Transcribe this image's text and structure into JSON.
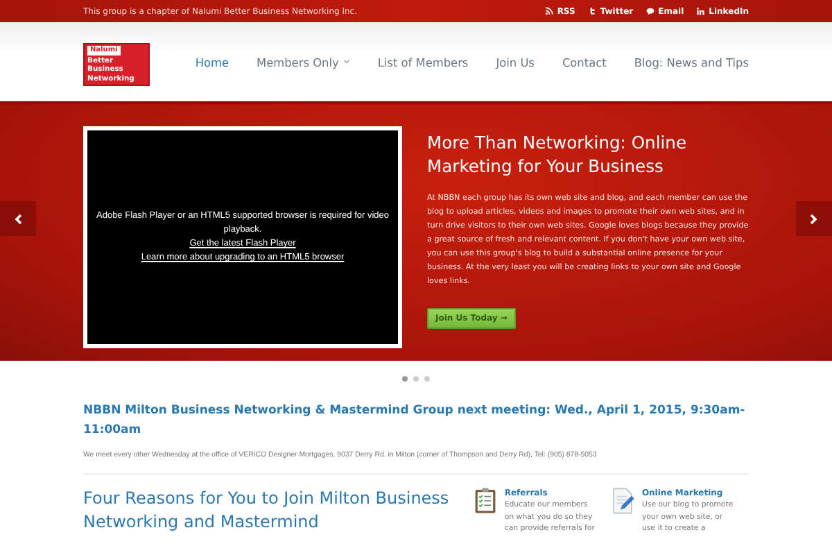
{
  "top_bar": {
    "tagline": "This group is a chapter of Nalumi Better Business Networking Inc.",
    "links": [
      {
        "kind": "rss",
        "label": "RSS"
      },
      {
        "kind": "twitter",
        "label": "Twitter"
      },
      {
        "kind": "email",
        "label": "Email"
      },
      {
        "kind": "linkedin",
        "label": "LinkedIn"
      }
    ]
  },
  "header": {
    "logo": {
      "brand": "Nalumi",
      "lines": [
        "Better",
        "Business",
        "Networking"
      ]
    },
    "nav": [
      {
        "label": "Home",
        "selected": true,
        "dropdown": false
      },
      {
        "label": "Members Only",
        "selected": false,
        "dropdown": true
      },
      {
        "label": "List of Members",
        "selected": false,
        "dropdown": false
      },
      {
        "label": "Join Us",
        "selected": false,
        "dropdown": false
      },
      {
        "label": "Contact",
        "selected": false,
        "dropdown": false
      },
      {
        "label": "Blog: News and Tips",
        "selected": false,
        "dropdown": false
      }
    ]
  },
  "slider": {
    "video": {
      "message": "Adobe Flash Player or an HTML5 supported browser is required for video playback.",
      "links": [
        "Get the latest Flash Player",
        "Learn more about upgrading to an HTML5 browser"
      ]
    },
    "heading": "More Than Networking: Online Marketing for Your Business",
    "body": "At NBBN each group has its own web site and blog, and each member can use the blog to upload articles, videos and images to promote their own web sites, and in turn drive visitors to their own web sites. Google loves blogs because they provide a great source of fresh and relevant content. If you don't have your own web site, you can use this group's blog to build a substantial online presence for your business. At the very least you will be creating links to your own site and Google loves links.",
    "button": "Join Us Today →",
    "dots": [
      {
        "selected": true
      },
      {
        "selected": false
      },
      {
        "selected": false
      }
    ]
  },
  "meeting": {
    "title": "NBBN Milton Business Networking & Mastermind Group next meeting: Wed., April 1, 2015, 9:30am-11:00am",
    "text": "We meet every other Wednesday at the office of VERICO Designer Mortgages, 9037 Derry Rd. in Milton (corner of Thompson and Derry Rd), Tel: (905) 878-5053"
  },
  "reasons": {
    "heading": "Four Reasons for You to Join Milton Business Networking and Mastermind",
    "features": [
      {
        "kind": "checklist",
        "title": "Referrals",
        "lines": [
          "Educate our members",
          "on what you do so they",
          "can provide referrals for"
        ]
      },
      {
        "kind": "document",
        "title": "Online Marketing",
        "lines": [
          "Use our blog to promote",
          "your own web site, or",
          "use it to create a"
        ]
      }
    ]
  }
}
